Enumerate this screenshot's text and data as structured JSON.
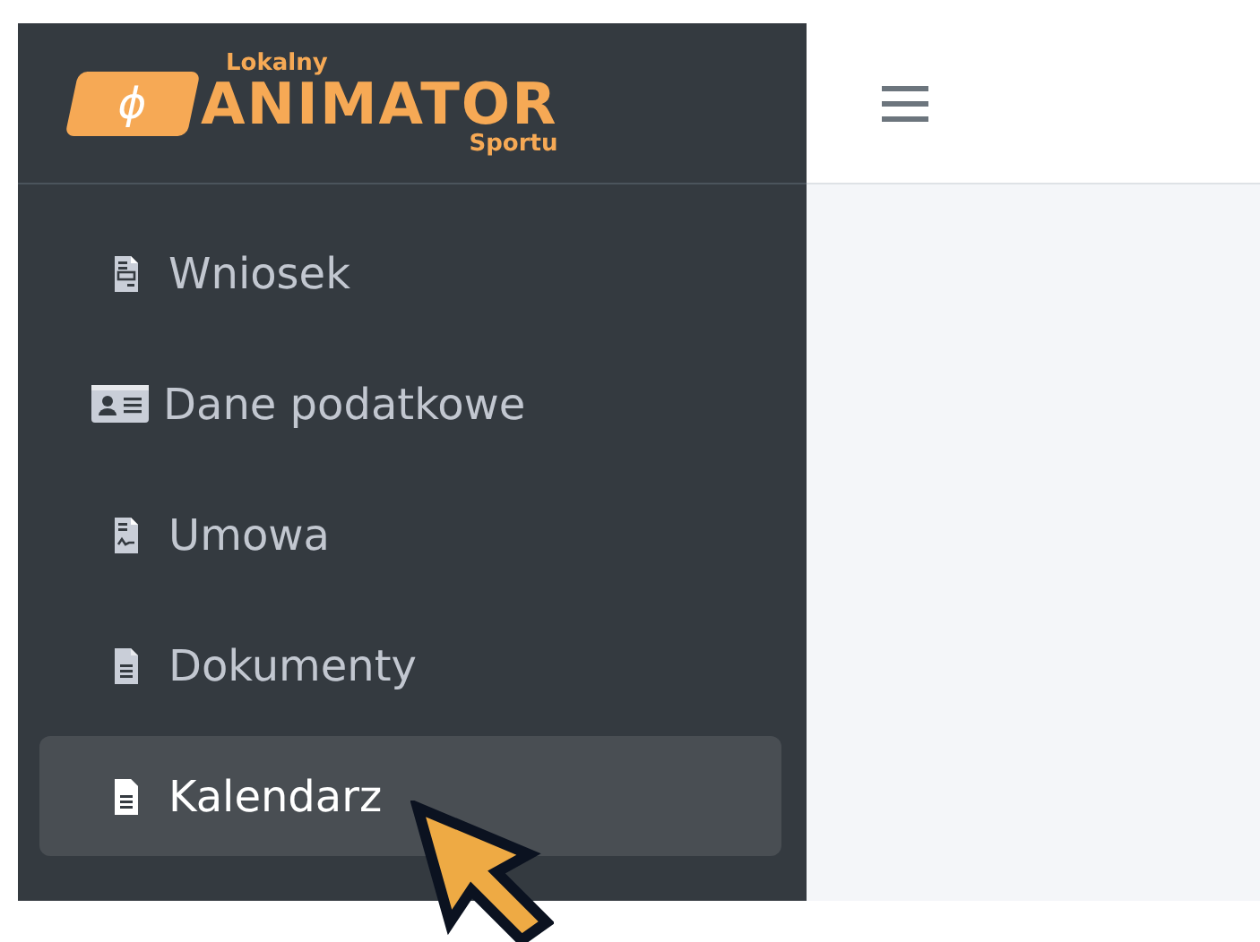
{
  "logo": {
    "top": "Lokalny",
    "main": "ANIMATOR",
    "bottom": "Sportu",
    "symbol": "ϕ"
  },
  "sidebar": {
    "items": [
      {
        "label": "Wniosek",
        "kind": "form",
        "selected": false
      },
      {
        "label": "Dane podatkowe",
        "kind": "idcard",
        "selected": false
      },
      {
        "label": "Umowa",
        "kind": "signature",
        "selected": false
      },
      {
        "label": "Dokumenty",
        "kind": "document",
        "selected": false
      },
      {
        "label": "Kalendarz",
        "kind": "document",
        "selected": true
      }
    ]
  }
}
